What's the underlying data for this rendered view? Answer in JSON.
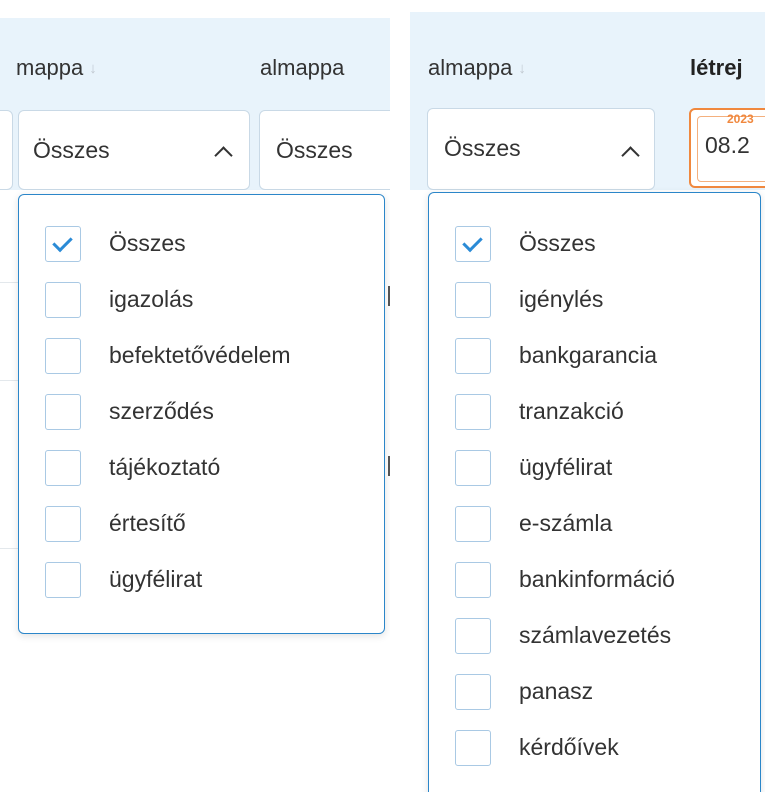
{
  "left": {
    "headers": {
      "mappa": "mappa",
      "almappa": "almappa"
    },
    "filters": {
      "mappa_value": "Összes",
      "almappa_value": "Összes"
    },
    "dropdown_options": [
      {
        "label": "Összes",
        "checked": true
      },
      {
        "label": "igazolás",
        "checked": false
      },
      {
        "label": "befektetővédelem",
        "checked": false
      },
      {
        "label": "szerződés",
        "checked": false
      },
      {
        "label": "tájékoztató",
        "checked": false
      },
      {
        "label": "értesítő",
        "checked": false
      },
      {
        "label": "ügyfélirat",
        "checked": false
      }
    ]
  },
  "right": {
    "headers": {
      "almappa": "almappa",
      "letrehozva": "létrej"
    },
    "filters": {
      "almappa_value": "Összes",
      "date_year": "2023",
      "date_value": "08.2"
    },
    "dropdown_options": [
      {
        "label": "Összes",
        "checked": true
      },
      {
        "label": "igénylés",
        "checked": false
      },
      {
        "label": "bankgarancia",
        "checked": false
      },
      {
        "label": "tranzakció",
        "checked": false
      },
      {
        "label": "ügyfélirat",
        "checked": false
      },
      {
        "label": "e-számla",
        "checked": false
      },
      {
        "label": "bankinformáció",
        "checked": false
      },
      {
        "label": "számlavezetés",
        "checked": false
      },
      {
        "label": "panasz",
        "checked": false
      },
      {
        "label": "kérdőívek",
        "checked": false
      }
    ]
  },
  "icons": {
    "sort": "sort-arrow-down-icon",
    "chevron": "chevron-up-icon",
    "check": "checkmark-icon"
  },
  "colors": {
    "accent": "#2b86c9",
    "header_bg": "#e8f3fb",
    "date_border": "#f0883e"
  }
}
